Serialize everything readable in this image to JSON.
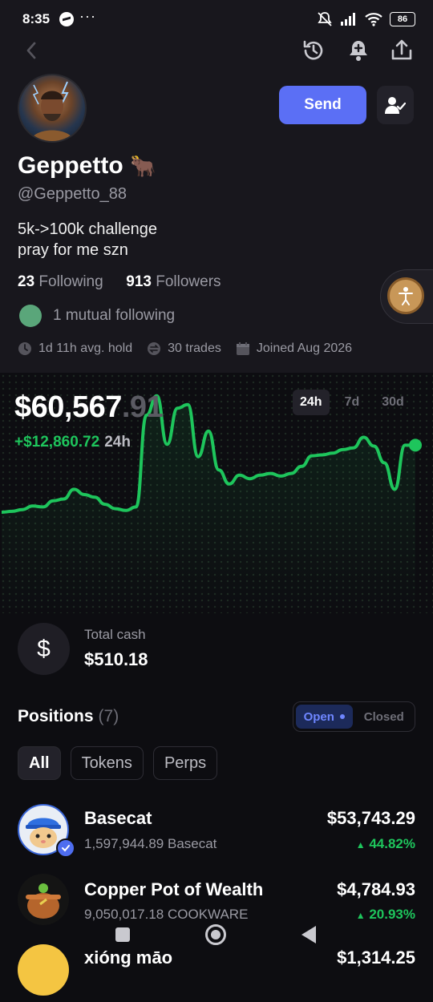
{
  "status_bar": {
    "time": "8:35",
    "battery": "86"
  },
  "profile": {
    "name": "Geppetto",
    "name_emoji": "🐂",
    "handle": "@Geppetto_88",
    "bio_line1": "5k->100k challenge",
    "bio_line2": "pray for me szn",
    "following_count": "23",
    "following_label": "Following",
    "followers_count": "913",
    "followers_label": "Followers",
    "mutual_text": "1 mutual following",
    "avg_hold": "1d 11h avg. hold",
    "trades": "30 trades",
    "joined": "Joined Aug 2026"
  },
  "actions": {
    "send_label": "Send"
  },
  "portfolio": {
    "balance_main": "$60,567",
    "balance_decimals": ".91",
    "change_value": "+$12,860.72",
    "change_period": "24h",
    "ranges": [
      "24h",
      "7d",
      "30d"
    ],
    "active_range": "24h",
    "line_color": "#1ec55c"
  },
  "chart_data": {
    "type": "line",
    "title": "",
    "x_unit": "time (24h window)",
    "series": [
      {
        "values": [
          60,
          61,
          63,
          67,
          66,
          73,
          75,
          86,
          80,
          77,
          69,
          64,
          62,
          66,
          170,
          192,
          137,
          178,
          182,
          123,
          152,
          108,
          92,
          102,
          98,
          102,
          104,
          101,
          104,
          112,
          124,
          125,
          127,
          131,
          133,
          145,
          135,
          116,
          86,
          136,
          136
        ]
      }
    ],
    "grid": "dotted background",
    "last_point_marker": true
  },
  "cash": {
    "label": "Total cash",
    "value": "$510.18",
    "icon": "dollar-icon"
  },
  "positions": {
    "title": "Positions",
    "count": "(7)",
    "toggle": [
      "Open",
      "Closed"
    ],
    "active_toggle": "Open",
    "filters": [
      "All",
      "Tokens",
      "Perps"
    ],
    "active_filter": "All",
    "items": [
      {
        "name": "Basecat",
        "amount": "1,597,944.89 Basecat",
        "value": "$53,743.29",
        "change": "44.82%"
      },
      {
        "name": "Copper Pot of Wealth",
        "amount": "9,050,017.18 COOKWARE",
        "value": "$4,784.93",
        "change": "20.93%"
      },
      {
        "name": "xióng māo",
        "amount": "",
        "value": "$1,314.25",
        "change": ""
      }
    ]
  }
}
